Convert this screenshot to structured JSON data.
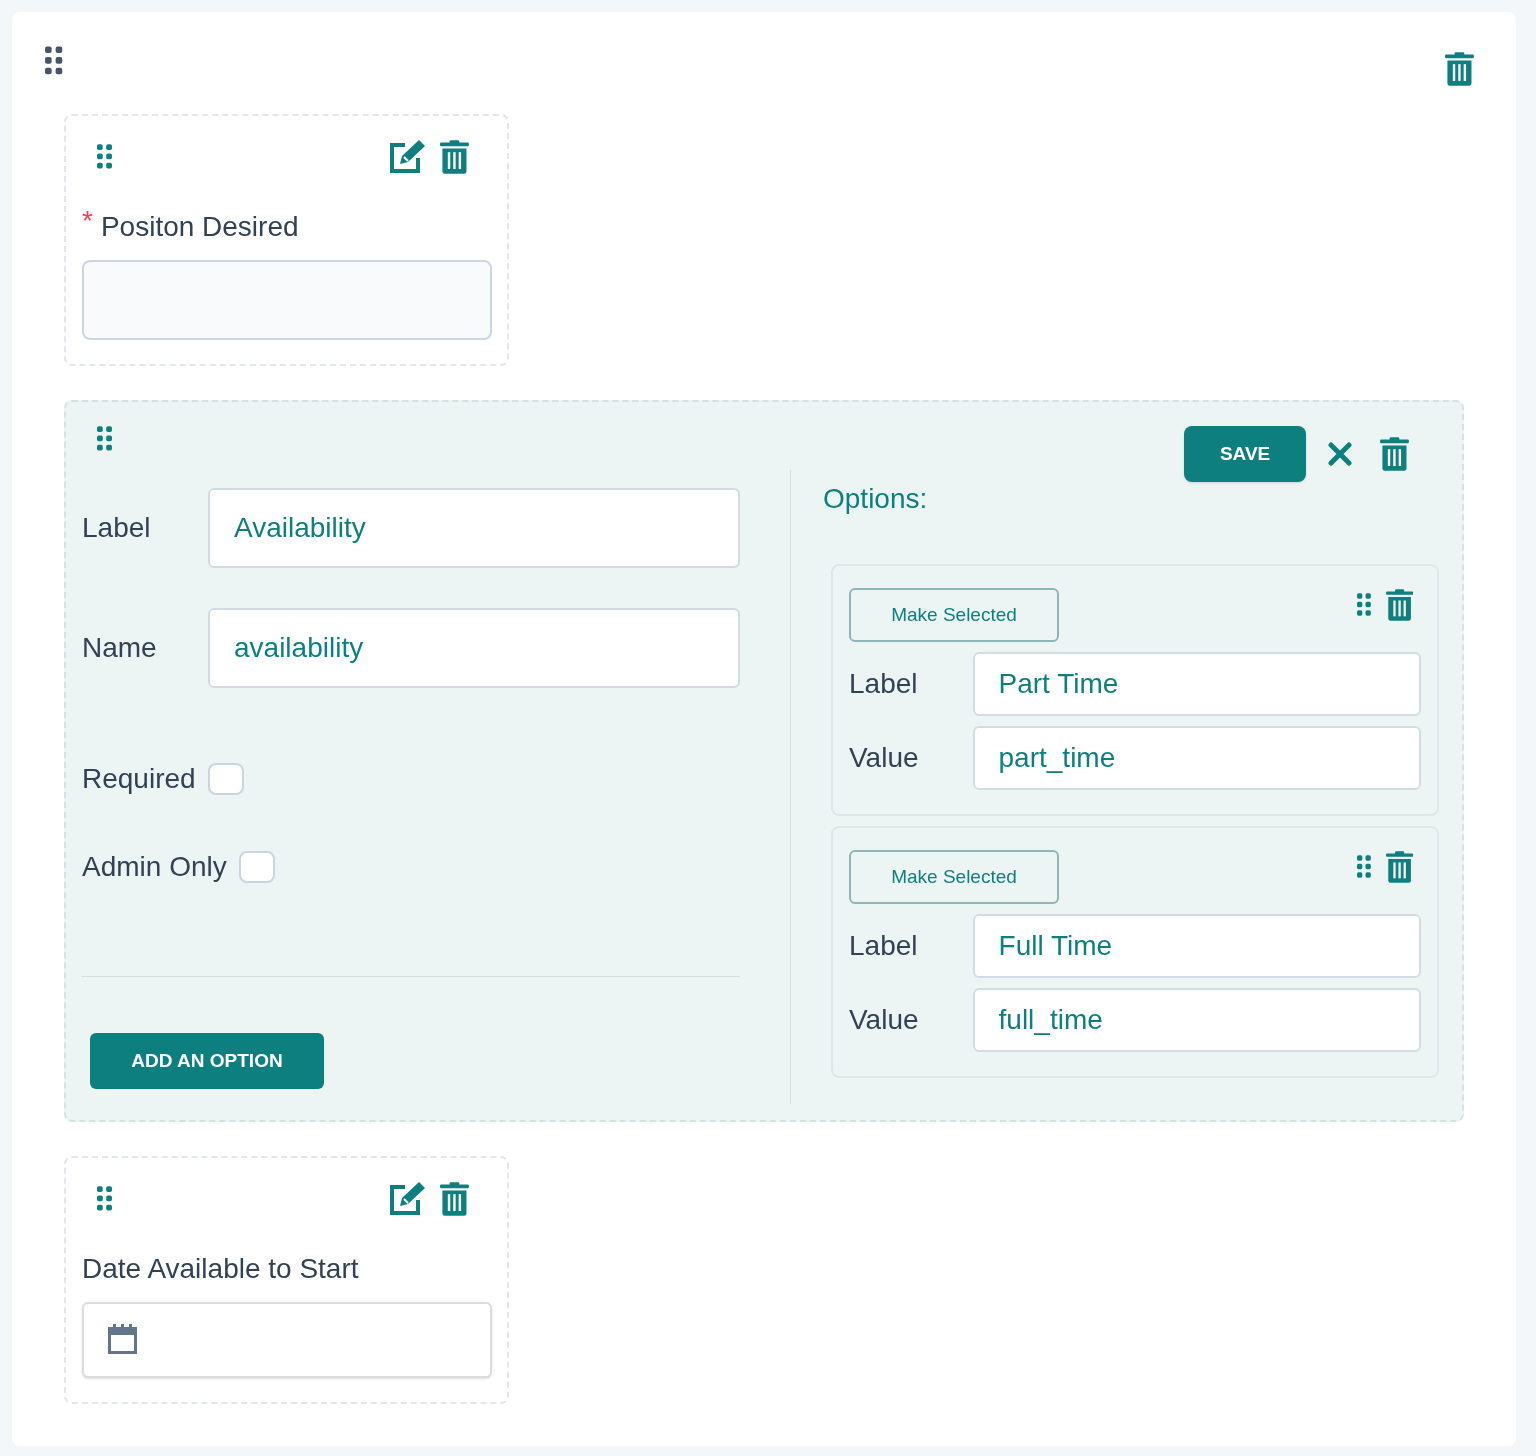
{
  "fields": [
    {
      "kind": "text",
      "required_mark": "*",
      "label": "Positon Desired"
    },
    {
      "kind": "editor",
      "save": "SAVE",
      "label_caption": "Label",
      "label_value": "Availability",
      "name_caption": "Name",
      "name_value": "availability",
      "toggles": [
        {
          "label": "Required",
          "checked": false
        },
        {
          "label": "Admin Only",
          "checked": false
        }
      ],
      "add_button": "ADD AN OPTION",
      "options_title": "Options:",
      "options": [
        {
          "button": "Make Selected",
          "label_caption": "Label",
          "label_value": "Part Time",
          "value_caption": "Value",
          "value_value": "part_time"
        },
        {
          "button": "Make Selected",
          "label_caption": "Label",
          "label_value": "Full Time",
          "value_caption": "Value",
          "value_value": "full_time"
        }
      ]
    },
    {
      "kind": "date",
      "label": "Date Available to Start"
    }
  ]
}
